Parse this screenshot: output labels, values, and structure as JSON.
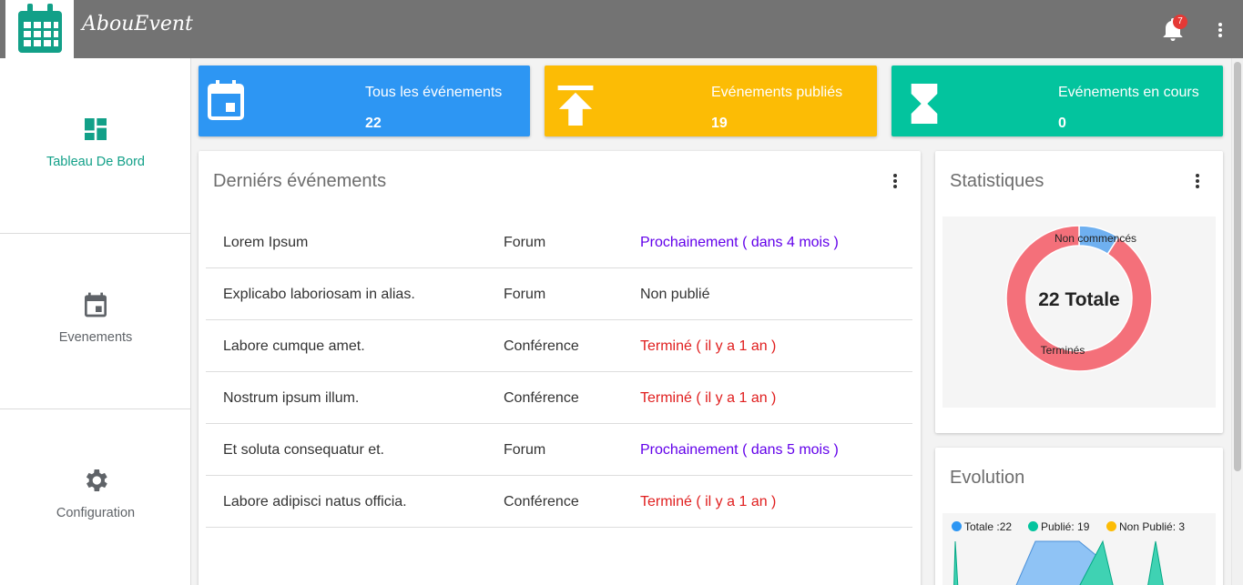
{
  "app": {
    "brand": "AbouEvent",
    "notification_count": "7"
  },
  "sidebar": {
    "items": [
      {
        "label": "Tableau De Bord",
        "icon": "dashboard-icon",
        "active": true
      },
      {
        "label": "Evenements",
        "icon": "calendar-icon",
        "active": false
      },
      {
        "label": "Configuration",
        "icon": "gear-icon",
        "active": false
      }
    ]
  },
  "cards": [
    {
      "title": "Tous les événements",
      "value": "22",
      "color": "#2d96f3",
      "icon": "calendar-icon"
    },
    {
      "title": "Evénements publiés",
      "value": "19",
      "color": "#fcbc05",
      "icon": "upload-icon"
    },
    {
      "title": "Evénements en cours",
      "value": "0",
      "color": "#03c49e",
      "icon": "hourglass-icon"
    }
  ],
  "latest": {
    "title": "Derniérs événements",
    "rows": [
      {
        "name": "Lorem Ipsum",
        "type": "Forum",
        "status": "Prochainement ( dans 4 mois )",
        "kind": "upcoming"
      },
      {
        "name": "Explicabo laboriosam in alias.",
        "type": "Forum",
        "status": "Non publié",
        "kind": "unpublished"
      },
      {
        "name": "Labore cumque amet.",
        "type": "Conférence",
        "status": "Terminé ( il y a 1 an )",
        "kind": "done"
      },
      {
        "name": "Nostrum ipsum illum.",
        "type": "Conférence",
        "status": "Terminé ( il y a 1 an )",
        "kind": "done"
      },
      {
        "name": "Et soluta consequatur et.",
        "type": "Forum",
        "status": "Prochainement ( dans 5 mois )",
        "kind": "upcoming"
      },
      {
        "name": "Labore adipisci natus officia.",
        "type": "Conférence",
        "status": "Terminé ( il y a 1 an )",
        "kind": "done"
      }
    ]
  },
  "stats": {
    "title": "Statistiques",
    "center_label": "22 Totale",
    "label_not_started": "Non commencés",
    "label_finished": "Terminés"
  },
  "evolution": {
    "title": "Evolution",
    "legend": [
      {
        "label": "Totale :22",
        "color": "#2d96f3"
      },
      {
        "label": "Publié: 19",
        "color": "#03c49e"
      },
      {
        "label": "Non Publié: 3",
        "color": "#fcbc05"
      }
    ]
  },
  "chart_data": {
    "type": "pie",
    "categories": [
      "Non commencés",
      "Terminés"
    ],
    "values": [
      2,
      20
    ],
    "colors": [
      "#6fb0f0",
      "#f4707a"
    ],
    "title": "",
    "legend": "none"
  }
}
